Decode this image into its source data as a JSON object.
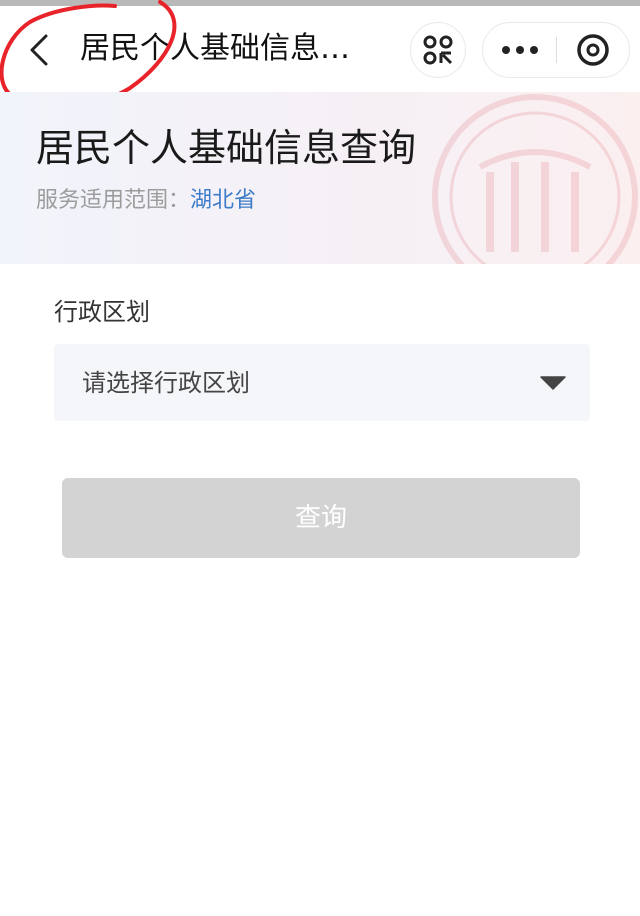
{
  "navbar": {
    "title": "居民个人基础信息…",
    "back_icon": "chevron-left-icon",
    "scan_icon": "scan-icon",
    "more_icon": "more-dots-icon",
    "close_icon": "close-circle-icon"
  },
  "banner": {
    "title": "居民个人基础信息查询",
    "scope_label": "服务适用范围：",
    "scope_value": "湖北省"
  },
  "form": {
    "region_label": "行政区划",
    "region_placeholder": "请选择行政区划",
    "query_button": "查询"
  },
  "colors": {
    "link_blue": "#3d7cc9",
    "button_disabled": "#d3d3d3",
    "select_bg": "#f5f6f9",
    "annotation_red": "#e8242a"
  }
}
